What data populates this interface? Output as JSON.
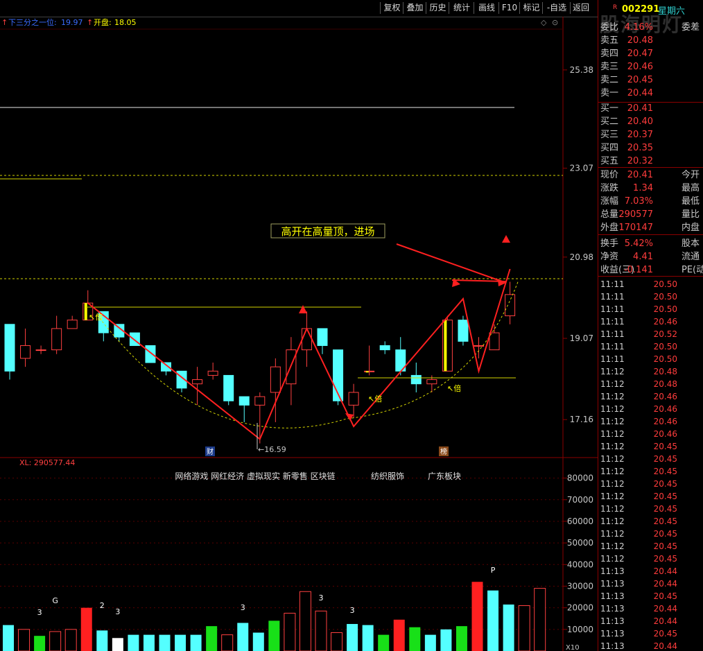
{
  "toolbar": {
    "buttons": [
      "复权",
      "叠加",
      "历史",
      "统计",
      "画线",
      "F10",
      "标记",
      "-自选",
      "返回"
    ]
  },
  "info_bar": {
    "line_label": "下三分之一位:",
    "line_value": "19.97",
    "open_label": "开盘:",
    "open_value": "18.05"
  },
  "chart_data": [
    {
      "type": "candlestick",
      "price_axis_ticks": [
        25.38,
        23.07,
        20.98,
        19.07,
        17.16
      ],
      "ylim": [
        16.3,
        26.6
      ],
      "candles": [
        {
          "open": 19.4,
          "close": 18.3,
          "high": 19.4,
          "low": 18.1
        },
        {
          "open": 18.6,
          "close": 18.9,
          "high": 19.3,
          "low": 18.4
        },
        {
          "open": 18.8,
          "close": 18.8,
          "high": 18.9,
          "low": 18.7
        },
        {
          "open": 18.8,
          "close": 19.3,
          "high": 19.6,
          "low": 18.7
        },
        {
          "open": 19.3,
          "close": 19.5,
          "high": 19.6,
          "low": 19.3
        },
        {
          "open": 19.5,
          "close": 19.9,
          "high": 20.2,
          "low": 19.5
        },
        {
          "open": 19.7,
          "close": 19.2,
          "high": 19.7,
          "low": 19.0
        },
        {
          "open": 19.4,
          "close": 19.1,
          "high": 19.4,
          "low": 19.0
        },
        {
          "open": 19.2,
          "close": 18.9,
          "high": 19.2,
          "low": 18.9
        },
        {
          "open": 18.9,
          "close": 18.5,
          "high": 18.9,
          "low": 18.5
        },
        {
          "open": 18.5,
          "close": 18.3,
          "high": 18.5,
          "low": 18.2
        },
        {
          "open": 18.3,
          "close": 17.9,
          "high": 18.3,
          "low": 17.8
        },
        {
          "open": 18.0,
          "close": 18.1,
          "high": 18.4,
          "low": 17.5
        },
        {
          "open": 18.2,
          "close": 18.3,
          "high": 18.5,
          "low": 18.1
        },
        {
          "open": 18.2,
          "close": 17.6,
          "high": 18.2,
          "low": 17.5
        },
        {
          "open": 17.7,
          "close": 17.5,
          "high": 17.7,
          "low": 17.1
        },
        {
          "open": 17.5,
          "close": 17.7,
          "high": 17.8,
          "low": 16.6
        },
        {
          "open": 17.8,
          "close": 18.4,
          "high": 18.6,
          "low": 17.1
        },
        {
          "open": 18.0,
          "close": 18.8,
          "high": 19.1,
          "low": 17.5
        },
        {
          "open": 18.8,
          "close": 19.3,
          "high": 19.7,
          "low": 18.4
        },
        {
          "open": 19.3,
          "close": 18.9,
          "high": 19.3,
          "low": 18.7
        },
        {
          "open": 18.8,
          "close": 17.6,
          "high": 18.8,
          "low": 17.5
        },
        {
          "open": 17.5,
          "close": 17.8,
          "high": 18.0,
          "low": 17.2
        },
        {
          "open": 18.3,
          "close": 18.3,
          "high": 18.9,
          "low": 18.2
        },
        {
          "open": 18.9,
          "close": 18.8,
          "high": 19.0,
          "low": 18.7
        },
        {
          "open": 18.8,
          "close": 18.3,
          "high": 19.1,
          "low": 18.2
        },
        {
          "open": 18.2,
          "close": 18.0,
          "high": 18.5,
          "low": 17.8
        },
        {
          "open": 18.0,
          "close": 18.1,
          "high": 18.2,
          "low": 17.8
        },
        {
          "open": 18.3,
          "close": 19.5,
          "high": 19.6,
          "low": 18.3
        },
        {
          "open": 19.5,
          "close": 19.0,
          "high": 19.6,
          "low": 18.9
        },
        {
          "open": 18.9,
          "close": 18.9,
          "high": 19.1,
          "low": 18.6
        },
        {
          "open": 18.8,
          "close": 19.2,
          "high": 19.4,
          "low": 18.8
        },
        {
          "open": 19.6,
          "close": 20.1,
          "high": 20.4,
          "low": 19.4
        }
      ],
      "annotation": "高开在高量顶，进场",
      "labels": {
        "low_price": "16.59",
        "bei": "倍",
        "cai": "财",
        "bang": "榜"
      }
    },
    {
      "type": "bar",
      "title": "XL: 290577.44",
      "volume_axis_ticks": [
        80000,
        70000,
        60000,
        50000,
        40000,
        30000,
        20000,
        10000
      ],
      "ylim": [
        0,
        85000
      ],
      "values": [
        12000,
        10000,
        7000,
        9000,
        10000,
        20000,
        9500,
        6000,
        7500,
        7500,
        7500,
        7500,
        7500,
        11500,
        7500,
        13000,
        8500,
        14000,
        17500,
        27500,
        18500,
        8500,
        12500,
        12000,
        7500,
        14500,
        11000,
        7500,
        10000,
        11500,
        32000,
        28000,
        21500,
        21000,
        29000
      ],
      "colors": [
        "cyan",
        "hollow",
        "green",
        "hollow",
        "hollow",
        "red",
        "cyan",
        "white",
        "cyan",
        "cyan",
        "cyan",
        "cyan",
        "cyan",
        "green",
        "hollow",
        "cyan",
        "cyan",
        "green",
        "hollow",
        "hollow",
        "hollow",
        "hollow",
        "cyan",
        "cyan",
        "green",
        "red",
        "green",
        "cyan",
        "cyan",
        "green",
        "red",
        "cyan",
        "cyan",
        "hollow",
        "hollow"
      ],
      "marks": [
        "3",
        "G",
        "2",
        "3",
        "3",
        "3",
        "3",
        "P"
      ],
      "sectors": [
        "网络游戏 网红经济 虚拟现实 新零售 区块链",
        "纺织服饰",
        "广东板块"
      ],
      "axis_tag": "X10"
    }
  ],
  "right_panel": {
    "stock_code": "002291",
    "weekday": "星期六",
    "watermark": "股海明灯",
    "order_book": [
      {
        "label": "委比",
        "value": "4.16%",
        "extra": "委差"
      },
      {
        "label": "卖五",
        "value": "20.48",
        "extra": ""
      },
      {
        "label": "卖四",
        "value": "20.47",
        "extra": ""
      },
      {
        "label": "卖三",
        "value": "20.46",
        "extra": ""
      },
      {
        "label": "卖二",
        "value": "20.45",
        "extra": ""
      },
      {
        "label": "卖一",
        "value": "20.44",
        "extra": ""
      },
      {
        "label": "买一",
        "value": "20.41",
        "extra": ""
      },
      {
        "label": "买二",
        "value": "20.40",
        "extra": ""
      },
      {
        "label": "买三",
        "value": "20.37",
        "extra": ""
      },
      {
        "label": "买四",
        "value": "20.35",
        "extra": ""
      },
      {
        "label": "买五",
        "value": "20.32",
        "extra": ""
      }
    ],
    "quote": [
      {
        "label": "现价",
        "value": "20.41",
        "extra": "今开"
      },
      {
        "label": "涨跌",
        "value": "1.34",
        "extra": "最高"
      },
      {
        "label": "涨幅",
        "value": "7.03%",
        "extra": "最低"
      },
      {
        "label": "总量",
        "value": "290577",
        "extra": "量比"
      },
      {
        "label": "外盘",
        "value": "170147",
        "extra": "内盘"
      },
      {
        "label": "换手",
        "value": "5.42%",
        "extra": "股本"
      },
      {
        "label": "净资",
        "value": "4.41",
        "extra": "流通"
      },
      {
        "label": "收益(三)",
        "value": "-0.141",
        "extra": "PE(动"
      }
    ],
    "ticks": [
      {
        "time": "11:11",
        "price": "20.50"
      },
      {
        "time": "11:11",
        "price": "20.50"
      },
      {
        "time": "11:11",
        "price": "20.50"
      },
      {
        "time": "11:11",
        "price": "20.46"
      },
      {
        "time": "11:11",
        "price": "20.52"
      },
      {
        "time": "11:11",
        "price": "20.50"
      },
      {
        "time": "11:11",
        "price": "20.50"
      },
      {
        "time": "11:12",
        "price": "20.48"
      },
      {
        "time": "11:12",
        "price": "20.48"
      },
      {
        "time": "11:12",
        "price": "20.46"
      },
      {
        "time": "11:12",
        "price": "20.46"
      },
      {
        "time": "11:12",
        "price": "20.46"
      },
      {
        "time": "11:12",
        "price": "20.46"
      },
      {
        "time": "11:12",
        "price": "20.45"
      },
      {
        "time": "11:12",
        "price": "20.45"
      },
      {
        "time": "11:12",
        "price": "20.45"
      },
      {
        "time": "11:12",
        "price": "20.45"
      },
      {
        "time": "11:12",
        "price": "20.45"
      },
      {
        "time": "11:12",
        "price": "20.45"
      },
      {
        "time": "11:12",
        "price": "20.45"
      },
      {
        "time": "11:12",
        "price": "20.45"
      },
      {
        "time": "11:12",
        "price": "20.45"
      },
      {
        "time": "11:12",
        "price": "20.45"
      },
      {
        "time": "11:13",
        "price": "20.44"
      },
      {
        "time": "11:13",
        "price": "20.44"
      },
      {
        "time": "11:13",
        "price": "20.45"
      },
      {
        "time": "11:13",
        "price": "20.44"
      },
      {
        "time": "11:13",
        "price": "20.44"
      },
      {
        "time": "11:13",
        "price": "20.45"
      },
      {
        "time": "11:13",
        "price": "20.44"
      },
      {
        "time": "11:13",
        "price": "20.44"
      }
    ]
  }
}
